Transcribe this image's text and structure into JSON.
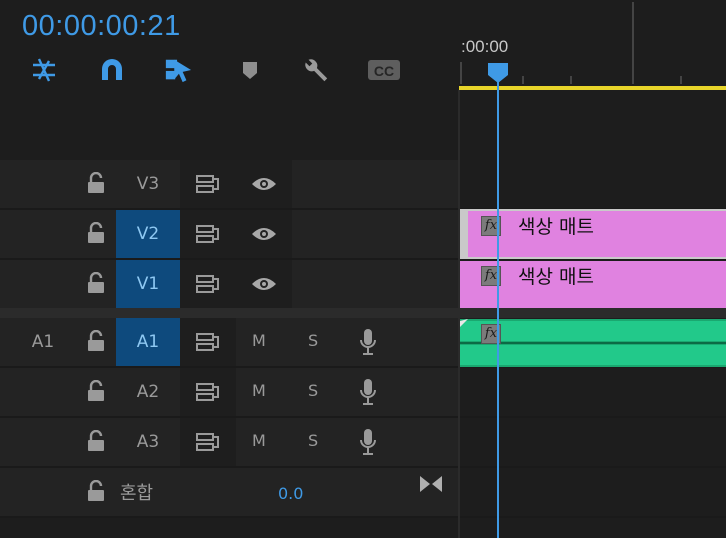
{
  "header": {
    "timecode": "00:00:00:21",
    "tools": [
      "snap-icon",
      "magnet-icon",
      "linked-selection-icon",
      "marker-icon",
      "wrench-icon",
      "captions-icon"
    ],
    "captions_label": "CC"
  },
  "ruler": {
    "time_label": ":00:00"
  },
  "video_tracks": [
    {
      "name": "V3",
      "active": false
    },
    {
      "name": "V2",
      "active": true
    },
    {
      "name": "V1",
      "active": true
    }
  ],
  "audio_tracks": [
    {
      "source": "A1",
      "name": "A1",
      "active": true,
      "mute": "M",
      "solo": "S"
    },
    {
      "source": "",
      "name": "A2",
      "active": false,
      "mute": "M",
      "solo": "S"
    },
    {
      "source": "",
      "name": "A3",
      "active": false,
      "mute": "M",
      "solo": "S"
    }
  ],
  "mix_track": {
    "name": "혼합",
    "value": "0.0"
  },
  "clips": {
    "v2": {
      "label": "색상 매트",
      "fx": "fx"
    },
    "v1": {
      "label": "색상 매트",
      "fx": "fx"
    },
    "a1": {
      "fx": "fx"
    }
  },
  "colors": {
    "accent": "#3f9ae6",
    "clip_video": "#e082e0",
    "clip_audio": "#1fbf7e",
    "work_area": "#e8d52a",
    "track_target": "#0e4a7d"
  }
}
